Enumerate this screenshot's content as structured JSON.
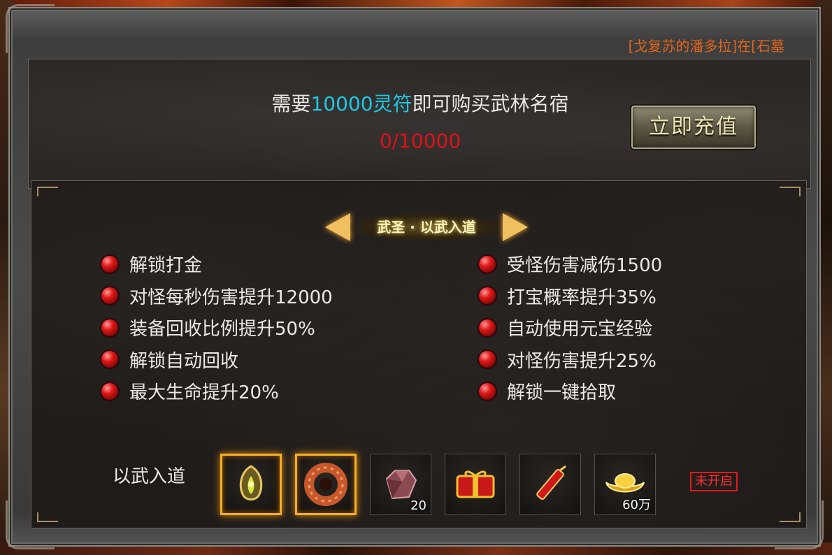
{
  "top_banner": "[戈复苏的潘多拉]在[石墓",
  "header": {
    "need_prefix": "需要",
    "need_amount": "10000",
    "need_currency": "灵符",
    "need_suffix": "即可购买武林名宿",
    "progress": "0/10000",
    "recharge_label": "立即充值"
  },
  "tier": {
    "title": "武圣 · 以武入道"
  },
  "perks_left": [
    "解锁打金",
    "对怪每秒伤害提升12000",
    "装备回收比例提升50%",
    "解锁自动回收",
    "最大生命提升20%"
  ],
  "perks_right": [
    "受怪伤害减伤1500",
    "打宝概率提升35%",
    "自动使用元宝经验",
    "对怪伤害提升25%",
    "解锁一键拾取"
  ],
  "rewards": {
    "label": "以武入道",
    "items": [
      {
        "icon": "amulet-icon",
        "qty": "",
        "highlighted": true
      },
      {
        "icon": "ring-icon",
        "qty": "",
        "highlighted": true
      },
      {
        "icon": "gem-icon",
        "qty": "20",
        "highlighted": false
      },
      {
        "icon": "gift-box-icon",
        "qty": "",
        "highlighted": false
      },
      {
        "icon": "firecracker-icon",
        "qty": "",
        "highlighted": false
      },
      {
        "icon": "gold-ingot-icon",
        "qty": "60万",
        "highlighted": false
      }
    ],
    "status": "未开启"
  },
  "colors": {
    "accent_cyan": "#1ec8e6",
    "progress_red": "#e0101a",
    "banner_orange": "#e0641c",
    "slot_glow": "#f3b020"
  }
}
